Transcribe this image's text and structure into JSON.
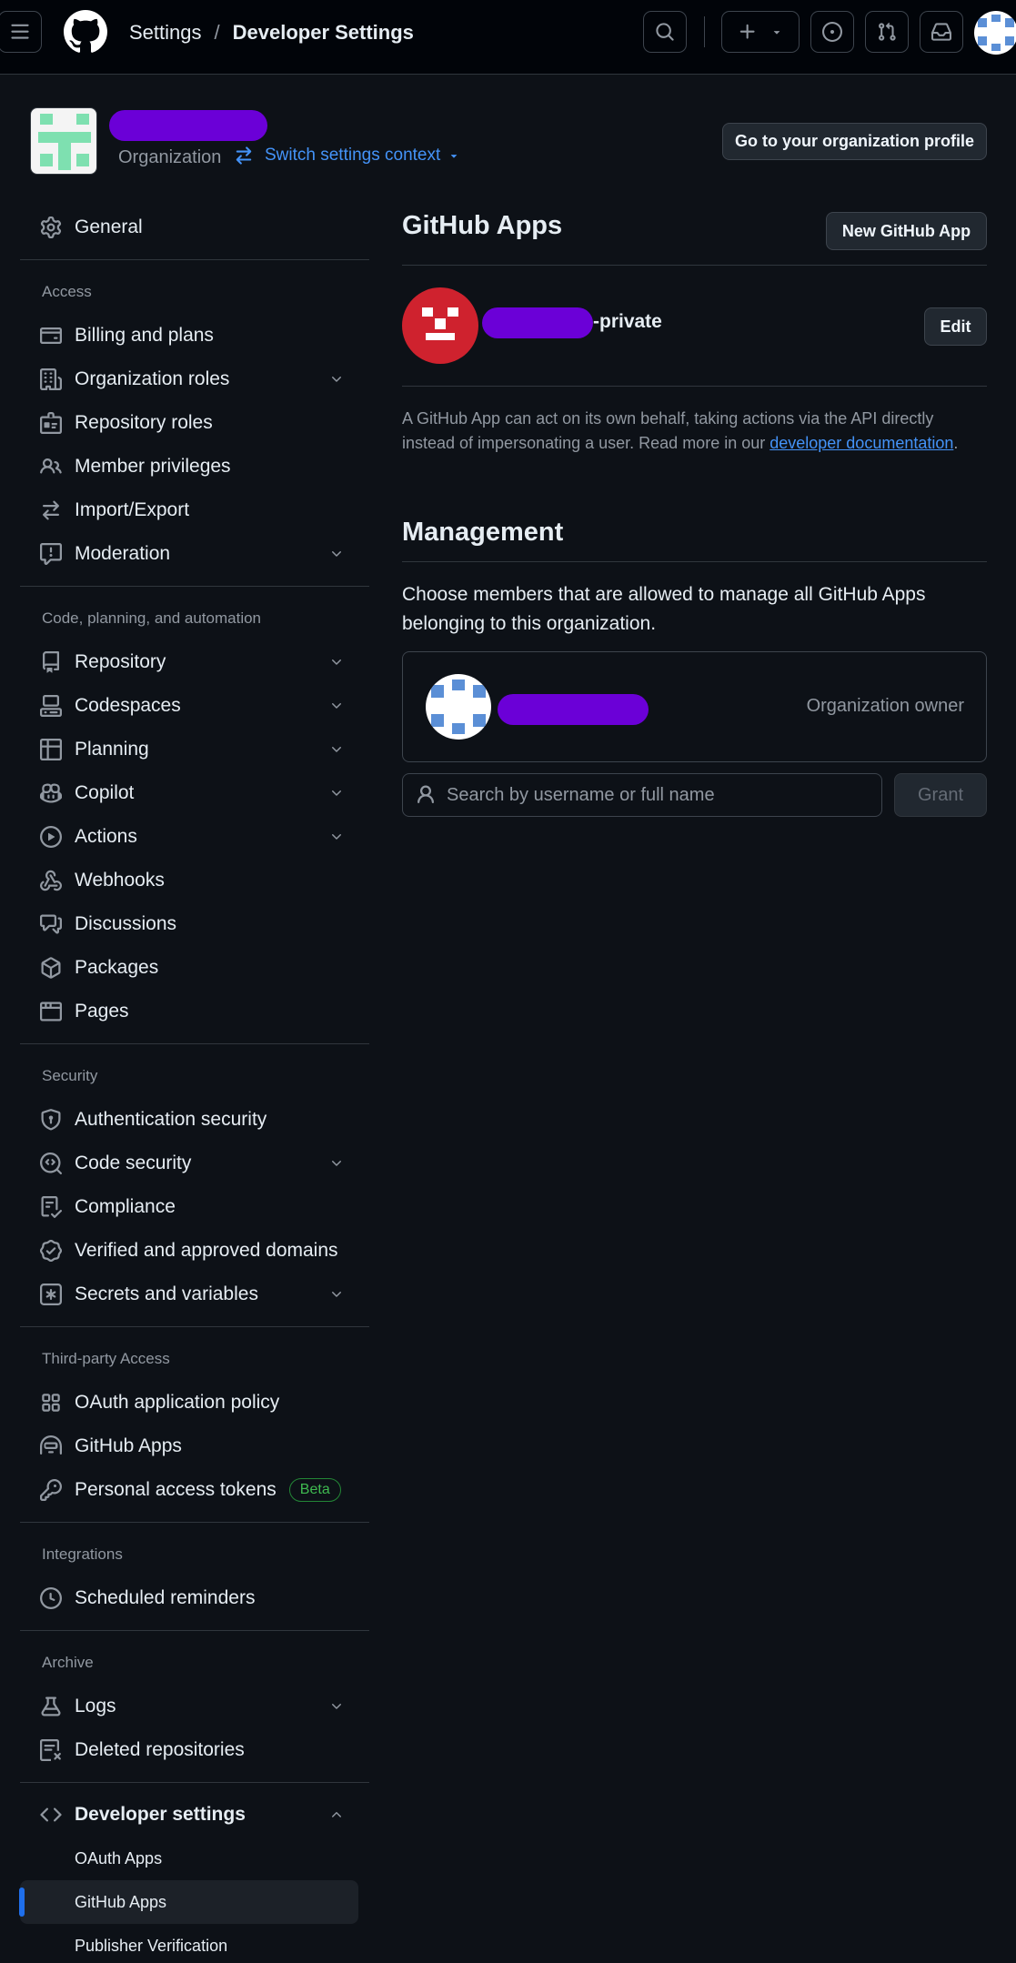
{
  "header": {
    "breadcrumb": [
      "Settings",
      "/",
      "Developer Settings"
    ]
  },
  "org": {
    "type_label": "Organization",
    "switch_label": "Switch settings context",
    "profile_button": "Go to your organization profile"
  },
  "sidebar": {
    "general": "General",
    "groups": {
      "access": "Access",
      "code": "Code, planning, and automation",
      "security": "Security",
      "third_party": "Third-party Access",
      "integrations": "Integrations",
      "archive": "Archive"
    },
    "access": [
      "Billing and plans",
      "Organization roles",
      "Repository roles",
      "Member privileges",
      "Import/Export",
      "Moderation"
    ],
    "code": [
      "Repository",
      "Codespaces",
      "Planning",
      "Copilot",
      "Actions",
      "Webhooks",
      "Discussions",
      "Packages",
      "Pages"
    ],
    "security": [
      "Authentication security",
      "Code security",
      "Compliance",
      "Verified and approved domains",
      "Secrets and variables"
    ],
    "third_party": [
      "OAuth application policy",
      "GitHub Apps",
      "Personal access tokens"
    ],
    "beta_badge": "Beta",
    "integrations": [
      "Scheduled reminders"
    ],
    "archive": [
      "Logs",
      "Deleted repositories"
    ],
    "developer": {
      "label": "Developer settings",
      "items": [
        "OAuth Apps",
        "GitHub Apps",
        "Publisher Verification"
      ]
    }
  },
  "main": {
    "title": "GitHub Apps",
    "new_button": "New GitHub App",
    "app_name_suffix": "-private",
    "edit_button": "Edit",
    "desc_prefix": "A GitHub App can act on its own behalf, taking actions via the API directly instead of impersonating a user. Read more in our ",
    "desc_link": "developer documentation",
    "desc_suffix": ".",
    "management_title": "Management",
    "management_desc": "Choose members that are allowed to manage all GitHub Apps belonging to this organization.",
    "member_role": "Organization owner",
    "search_placeholder": "Search by username or full name",
    "grant_button": "Grant"
  },
  "colors": {
    "accent": "#4493f8",
    "redaction": "#6b00d7",
    "app_avatar": "#cf222e",
    "beta": "#3fb950"
  }
}
